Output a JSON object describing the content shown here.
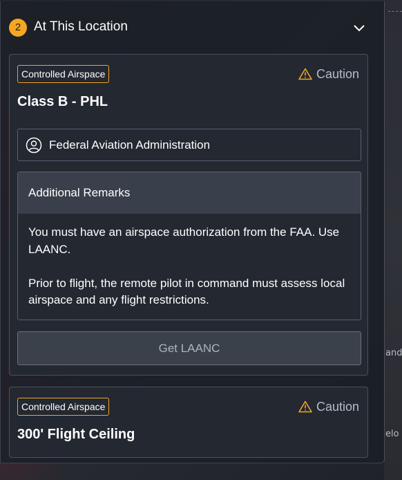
{
  "panel": {
    "count": "2",
    "title": "At This Location"
  },
  "cards": [
    {
      "tag": "Controlled Airspace",
      "status": "Caution",
      "title": "Class B - PHL",
      "authority": "Federal Aviation Administration",
      "remarks_heading": "Additional Remarks",
      "remarks": [
        "You must have an airspace authorization from the FAA. Use LAANC.",
        "Prior to flight, the remote pilot in command must assess local airspace and any flight restrictions."
      ],
      "action_label": "Get LAANC"
    },
    {
      "tag": "Controlled Airspace",
      "status": "Caution",
      "title": "300' Flight Ceiling"
    }
  ],
  "map": {
    "label_1": "and",
    "label_2": "elo"
  },
  "colors": {
    "accent": "#f5a623",
    "panel_bg": "#1b1f26",
    "card_border": "#4a5260"
  }
}
